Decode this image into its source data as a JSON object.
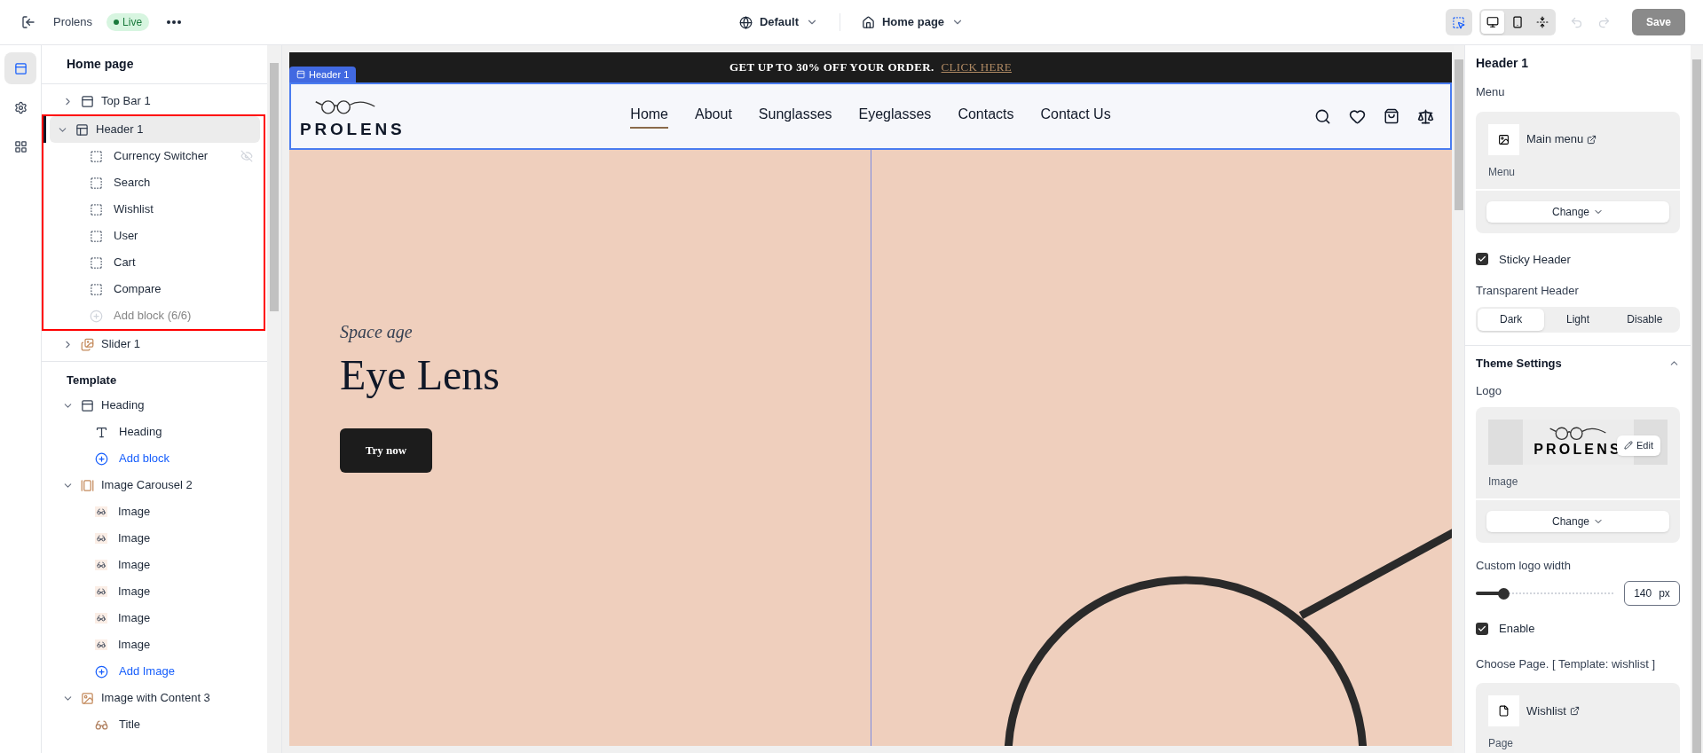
{
  "topbar": {
    "store": "Prolens",
    "status": "Live",
    "theme": "Default",
    "page": "Home page",
    "save": "Save",
    "inspect_selected": true,
    "devices": [
      {
        "kind": "desktop",
        "selected": true
      },
      {
        "kind": "mobile",
        "selected": false
      },
      {
        "kind": "fullscreen",
        "selected": false
      }
    ]
  },
  "rail": [
    {
      "kind": "sections",
      "selected": true
    },
    {
      "kind": "settings",
      "selected": false
    },
    {
      "kind": "apps",
      "selected": false
    }
  ],
  "tree": {
    "title": "Home page",
    "sections": [
      {
        "label": "Top Bar 1",
        "kind": "bar",
        "expanded": false,
        "selected": false,
        "highlighted": false
      },
      {
        "label": "Header 1",
        "kind": "header",
        "expanded": true,
        "selected": true,
        "highlighted": true,
        "children": [
          {
            "label": "Currency Switcher",
            "kind": "block",
            "hidden": true
          },
          {
            "label": "Search",
            "kind": "block",
            "hidden": false
          },
          {
            "label": "Wishlist",
            "kind": "block",
            "hidden": false
          },
          {
            "label": "User",
            "kind": "block",
            "hidden": false
          },
          {
            "label": "Cart",
            "kind": "block",
            "hidden": false
          },
          {
            "label": "Compare",
            "kind": "block",
            "hidden": false
          },
          {
            "label": "Add block (6/6)",
            "kind": "add",
            "disabled": true
          }
        ]
      },
      {
        "label": "Slider 1",
        "kind": "slider",
        "expanded": false,
        "selected": false,
        "highlighted": false
      }
    ],
    "template_title": "Template",
    "template": [
      {
        "label": "Heading",
        "kind": "bar",
        "expanded": true,
        "selected": false,
        "children": [
          {
            "label": "Heading",
            "kind": "text"
          },
          {
            "label": "Add block",
            "kind": "add",
            "disabled": false
          }
        ]
      },
      {
        "label": "Image Carousel 2",
        "kind": "carousel",
        "expanded": true,
        "selected": false,
        "children": [
          {
            "label": "Image",
            "kind": "image"
          },
          {
            "label": "Image",
            "kind": "image"
          },
          {
            "label": "Image",
            "kind": "image"
          },
          {
            "label": "Image",
            "kind": "image"
          },
          {
            "label": "Image",
            "kind": "image"
          },
          {
            "label": "Image",
            "kind": "image"
          },
          {
            "label": "Add Image",
            "kind": "add",
            "disabled": false
          }
        ]
      },
      {
        "label": "Image with Content 3",
        "kind": "content",
        "expanded": true,
        "selected": false,
        "children": [
          {
            "label": "Title",
            "kind": "title"
          }
        ]
      }
    ]
  },
  "preview": {
    "promo": "GET UP TO 30% OFF YOUR ORDER.",
    "promo_link": "CLICK HERE",
    "section_tag": "Header 1",
    "logo": "PROLENS",
    "nav": [
      {
        "label": "Home",
        "selected": true
      },
      {
        "label": "About",
        "selected": false
      },
      {
        "label": "Sunglasses",
        "selected": false
      },
      {
        "label": "Eyeglasses",
        "selected": false
      },
      {
        "label": "Contacts",
        "selected": false
      },
      {
        "label": "Contact Us",
        "selected": false
      }
    ],
    "hero": {
      "subtitle": "Space age",
      "title": "Eye Lens",
      "button": "Try now"
    }
  },
  "settings": {
    "title": "Header 1",
    "menu_label": "Menu",
    "menu_name": "Main menu",
    "menu_type": "Menu",
    "menu_change": "Change",
    "sticky": {
      "label": "Sticky Header",
      "checked": true
    },
    "transparent_label": "Transparent Header",
    "transparent_options": [
      {
        "label": "Dark",
        "selected": true
      },
      {
        "label": "Light",
        "selected": false
      },
      {
        "label": "Disable",
        "selected": false
      }
    ],
    "theme": {
      "title": "Theme Settings",
      "expanded": true,
      "logo_label": "Logo",
      "logo_text": "PROLENS",
      "edit": "Edit",
      "image_type": "Image",
      "change": "Change",
      "width_label": "Custom logo width",
      "width": {
        "level": 0.2,
        "value": "140",
        "unit": "px"
      },
      "enable": {
        "label": "Enable",
        "checked": true
      },
      "page_label": "Choose Page. [ Template: wishlist ]",
      "page_name": "Wishlist",
      "page_type": "Page"
    }
  }
}
